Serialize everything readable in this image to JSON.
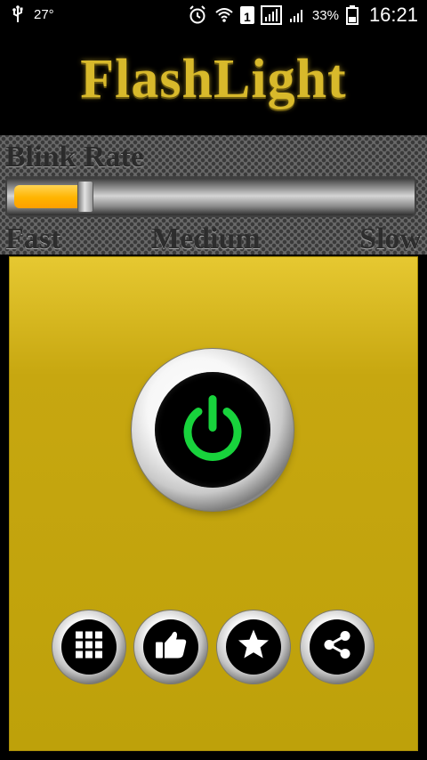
{
  "status_bar": {
    "temperature": "27°",
    "sim_slot": "1",
    "battery": "33%",
    "time": "16:21"
  },
  "app": {
    "title": "FlashLight"
  },
  "blink_rate": {
    "title": "Blink Rate",
    "labels": {
      "fast": "Fast",
      "medium": "Medium",
      "slow": "Slow"
    },
    "value": 0.18
  },
  "icons": {
    "power": "power-icon",
    "apps": "apps-grid-icon",
    "like": "thumbs-up-icon",
    "favorite": "star-icon",
    "share": "share-icon"
  },
  "colors": {
    "accent": "#d8b92b",
    "panel_yellow": "#c7a710",
    "power_green": "#18d33c"
  }
}
